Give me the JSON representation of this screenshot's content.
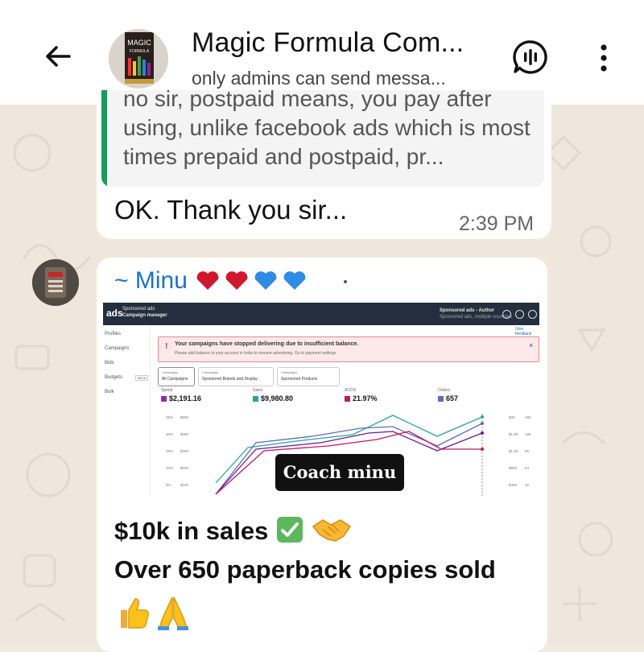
{
  "header": {
    "title": "Magic Formula Com...",
    "subtitle": "only admins can send messa...",
    "avatar_text": [
      "MAGIC",
      "FORMULA"
    ]
  },
  "message1": {
    "quoted_text": "no sir, postpaid means, you pay after using, unlike facebook ads which is most times prepaid and postpaid, pr...",
    "text": "OK. Thank you sir...",
    "time": "2:39 PM"
  },
  "message2": {
    "sender": "~ Minu",
    "sender_emojis": [
      "red-heart",
      "red-heart",
      "blue-heart",
      "blue-heart"
    ],
    "screenshot": {
      "brand": "ads",
      "top_small": [
        "Sponsored ads",
        "Campaign manager"
      ],
      "top_right": [
        "Sponsored ads - Author",
        "Sponsored ads, multiple countries"
      ],
      "help_link": "Give feedback",
      "sidebar_items": [
        "Profiles",
        "Campaigns",
        "Bids",
        "Budgets",
        "Bulk"
      ],
      "sidebar_badge": "BETA",
      "alert_title": "Your campaigns have stopped delivering due to insufficient balance.",
      "alert_body": "Please add balance to your account in India to resume advertising. Go to payment settings.",
      "tabs": [
        {
          "small": "Campaigns",
          "label": "All Campaigns"
        },
        {
          "small": "Campaigns",
          "label": "Sponsored Brands and Display"
        },
        {
          "small": "Campaigns",
          "label": "Sponsored Products"
        }
      ],
      "metrics": [
        {
          "label": "Spend",
          "value": "$2,191.16",
          "color": "#9c27b0"
        },
        {
          "label": "Sales",
          "value": "$9,980.80",
          "color": "#26a69a"
        },
        {
          "label": "ACOS",
          "value": "21.97%",
          "color": "#c2185b"
        },
        {
          "label": "Orders",
          "value": "657",
          "color": "#5c6bc0"
        }
      ],
      "y_left": [
        "25%",
        "20%",
        "15%",
        "10%",
        "5%"
      ],
      "y_left2": [
        "$500",
        "$400",
        "$300",
        "$200",
        "$100"
      ],
      "y_right": [
        "$2K",
        "$1.6K",
        "$1.2K",
        "$800",
        "$400"
      ],
      "y_right2": [
        "160",
        "128",
        "96",
        "64",
        "32"
      ],
      "watermark": "Coach minu"
    },
    "caption_line1": "$10k in sales",
    "caption_line1_emojis": [
      "check-mark-button",
      "handshake"
    ],
    "caption_line2": "Over 650 paperback copies sold",
    "caption_line3_emojis": [
      "thumbs-up",
      "folded-hands"
    ]
  },
  "colors": {
    "link_blue": "#1a73c9",
    "quote_green": "#1a9a5b",
    "wallpaper": "#efe7dc"
  }
}
